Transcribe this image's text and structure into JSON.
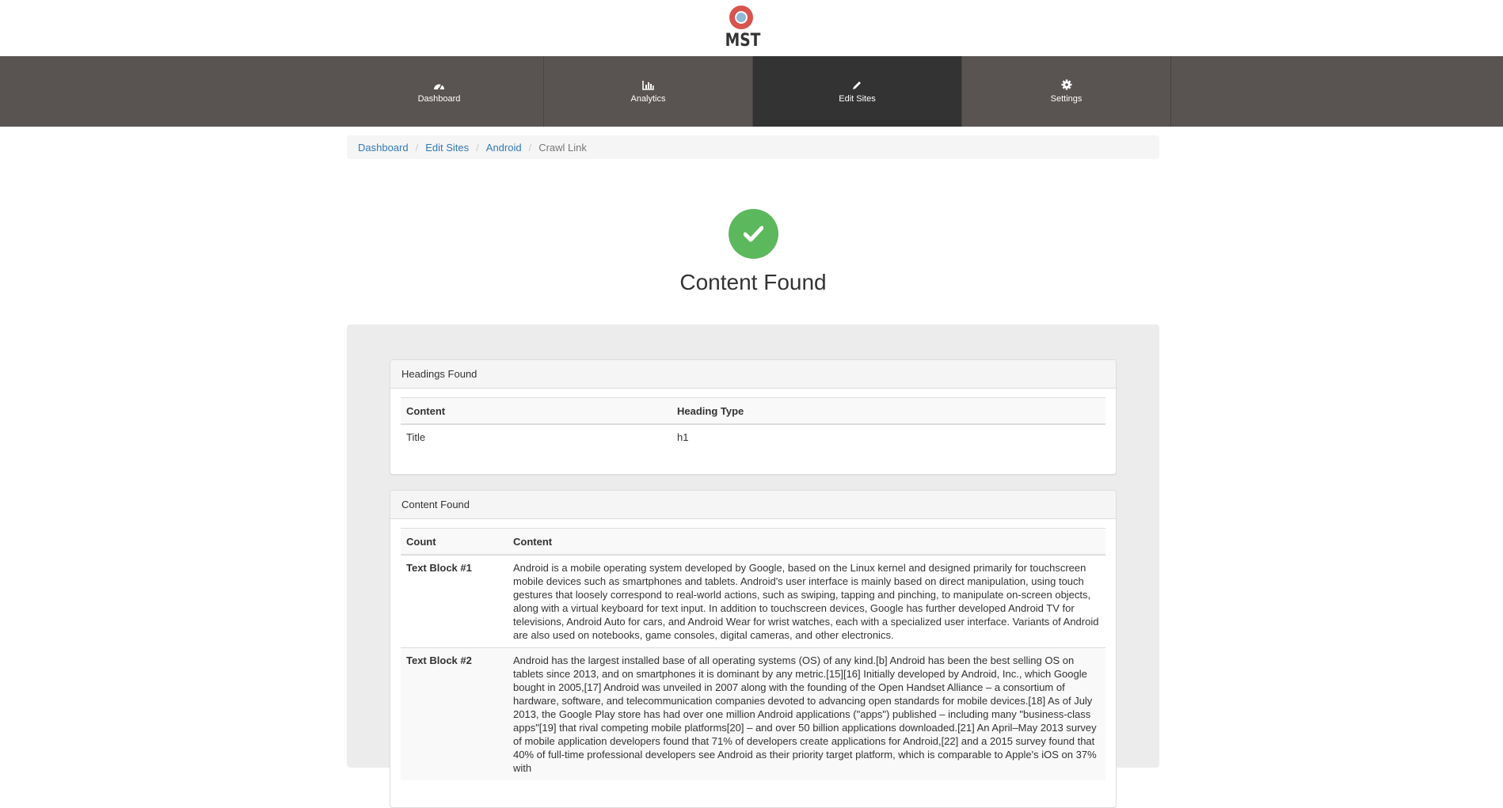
{
  "logo": {
    "text": "MST"
  },
  "nav": [
    {
      "label": "Dashboard",
      "icon": "dashboard-icon",
      "active": false
    },
    {
      "label": "Analytics",
      "icon": "bar-chart-icon",
      "active": false
    },
    {
      "label": "Edit Sites",
      "icon": "pencil-icon",
      "active": true
    },
    {
      "label": "Settings",
      "icon": "gear-icon",
      "active": false
    }
  ],
  "breadcrumb": {
    "items": [
      "Dashboard",
      "Edit Sites",
      "Android"
    ],
    "current": "Crawl Link"
  },
  "status": {
    "title": "Content Found",
    "color": "#5cb85c"
  },
  "headings_panel": {
    "title": "Headings Found",
    "columns": [
      "Content",
      "Heading Type"
    ],
    "rows": [
      {
        "content": "Title",
        "type": "h1"
      }
    ]
  },
  "content_panel": {
    "title": "Content Found",
    "columns": [
      "Count",
      "Content"
    ],
    "rows": [
      {
        "count": "Text Block #1",
        "content": "Android is a mobile operating system developed by Google, based on the Linux kernel and designed primarily for touchscreen mobile devices such as smartphones and tablets. Android's user interface is mainly based on direct manipulation, using touch gestures that loosely correspond to real-world actions, such as swiping, tapping and pinching, to manipulate on-screen objects, along with a virtual keyboard for text input. In addition to touchscreen devices, Google has further developed Android TV for televisions, Android Auto for cars, and Android Wear for wrist watches, each with a specialized user interface. Variants of Android are also used on notebooks, game consoles, digital cameras, and other electronics."
      },
      {
        "count": "Text Block #2",
        "content": "Android has the largest installed base of all operating systems (OS) of any kind.[b] Android has been the best selling OS on tablets since 2013, and on smartphones it is dominant by any metric.[15][16] Initially developed by Android, Inc., which Google bought in 2005,[17] Android was unveiled in 2007 along with the founding of the Open Handset Alliance – a consortium of hardware, software, and telecommunication companies devoted to advancing open standards for mobile devices.[18] As of July 2013, the Google Play store has had over one million Android applications (\"apps\") published – including many \"business-class apps\"[19] that rival competing mobile platforms[20] – and over 50 billion applications downloaded.[21] An April–May 2013 survey of mobile application developers found that 71% of developers create applications for Android,[22] and a 2015 survey found that 40% of full-time professional developers see Android as their priority target platform, which is comparable to Apple's iOS on 37% with"
      }
    ]
  }
}
